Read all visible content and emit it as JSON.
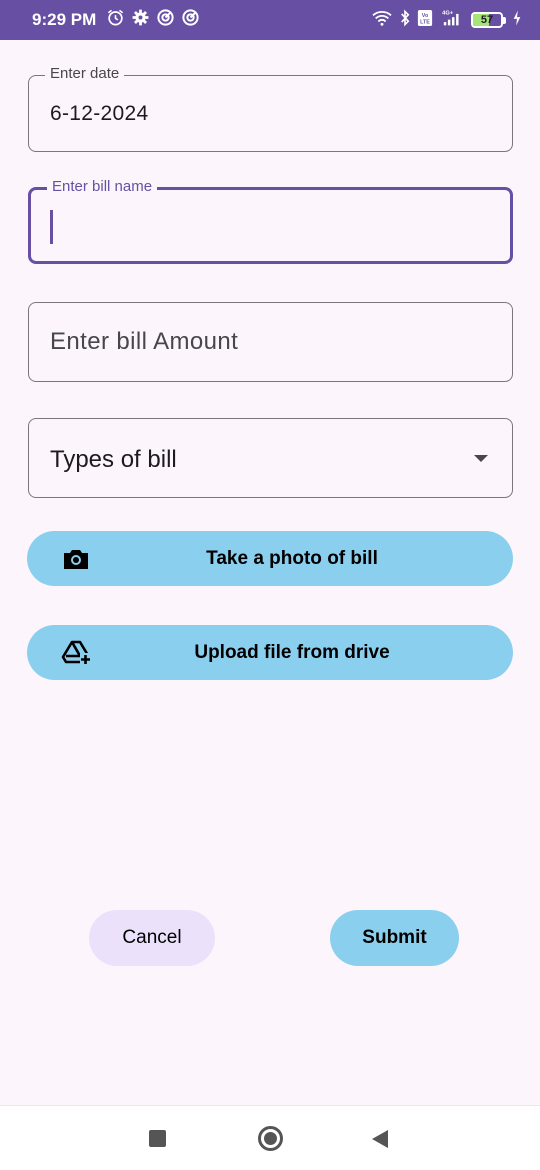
{
  "status_bar": {
    "time": "9:29 PM",
    "battery": "57",
    "network": "4G+",
    "left_icons": [
      "alarm-icon",
      "gear-icon",
      "circle-app-icon",
      "circle-app-icon"
    ],
    "right_icons": [
      "wifi-icon",
      "bluetooth-icon",
      "volte-icon",
      "signal-icon",
      "battery-icon",
      "charging-icon"
    ]
  },
  "form": {
    "date": {
      "label": "Enter date",
      "value": "6-12-2024"
    },
    "bill_name": {
      "label": "Enter bill name",
      "value": ""
    },
    "bill_amount": {
      "placeholder": "Enter bill Amount"
    },
    "bill_type": {
      "selected": "Types of bill"
    }
  },
  "actions": {
    "photo_label": "Take a photo of bill",
    "photo_icon": "camera-icon",
    "upload_label": "Upload file from drive",
    "upload_icon": "drive-add-icon"
  },
  "buttons": {
    "cancel": "Cancel",
    "submit": "Submit"
  },
  "colors": {
    "status_bar": "#6750a4",
    "primary": "#6750a4",
    "action_button": "#8bcfef",
    "cancel_button": "#ebe1fb",
    "background": "#fcf6fc"
  }
}
